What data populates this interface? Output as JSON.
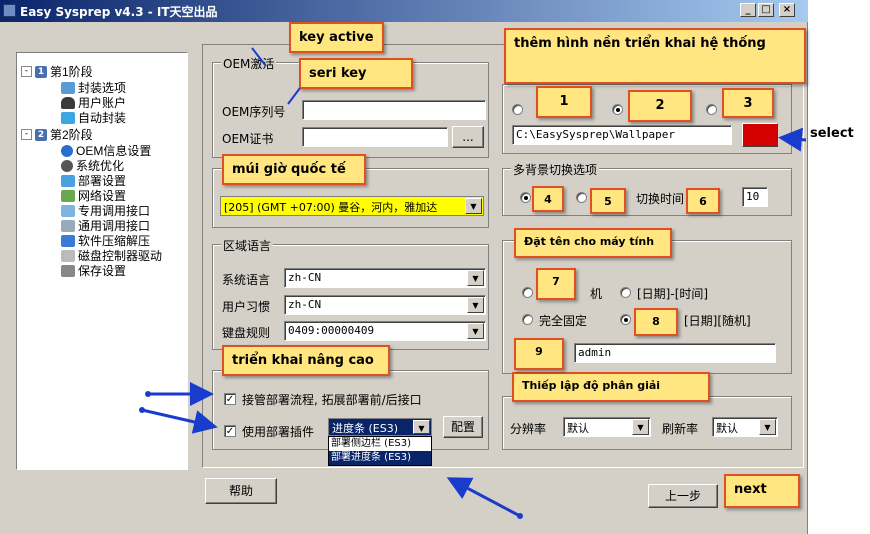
{
  "window": {
    "title": "Easy Sysprep v4.3 - IT天空出品",
    "min_label": "_",
    "max_label": "□",
    "close_label": "×"
  },
  "tree": {
    "stage1": {
      "num": "1",
      "label": "第1阶段"
    },
    "stage1_items": [
      "封装选项",
      "用户账户",
      "自动封装"
    ],
    "stage2": {
      "num": "2",
      "label": "第2阶段"
    },
    "stage2_items": [
      "OEM信息设置",
      "系统优化",
      "部署设置",
      "网络设置",
      "专用调用接口",
      "通用调用接口",
      "软件压缩解压",
      "磁盘控制器驱动",
      "保存设置"
    ]
  },
  "oem": {
    "group_label": "OEM激活",
    "serial_label": "OEM序列号",
    "serial_value": "",
    "cert_label": "OEM证书",
    "cert_value": "",
    "browse_label": "..."
  },
  "timezone": {
    "value": "[205] (GMT +07:00) 曼谷，河内，雅加达"
  },
  "locale": {
    "group_label": "区域语言",
    "system_language_label": "系统语言",
    "system_language_value": "zh-CN",
    "user_locale_label": "用户习惯",
    "user_locale_value": "zh-CN",
    "keyboard_label": "键盘规则",
    "keyboard_value": "0409:00000409"
  },
  "advanced": {
    "takeover_label": "接管部署流程, 拓展部署前/后接口",
    "plugin_label": "使用部署插件",
    "plugin_selected": "进度条 (ES3)",
    "plugin_options": [
      "部署侧边栏 (ES3)",
      "部署进度条 (ES3)"
    ],
    "config_label": "配置"
  },
  "wallpaper": {
    "path_value": "C:\\EasySysprep\\Wallpaper"
  },
  "multi_bg": {
    "group_label": "多背景切换选项",
    "interval_label": "切换时间",
    "interval_value": "10"
  },
  "computer_name": {
    "option_machine_suffix": "机",
    "option_date_time": "[日期]-[时间]",
    "option_fixed": "完全固定",
    "option_date_random_suffix": "[日期][随机]",
    "fixed_value": "admin"
  },
  "display": {
    "resolution_label": "分辨率",
    "resolution_value": "默认",
    "refresh_label": "刷新率",
    "refresh_value": "默认"
  },
  "footer": {
    "help_label": "帮助",
    "prev_label": "上一步"
  },
  "annotations": {
    "key_active": "key active",
    "seri_key": "seri key",
    "timezone": "múi giờ quốc tế",
    "wallpaper": "thêm hình nền triển khai hệ thống",
    "advanced": "triển khai nâng cao",
    "computer_name": "Đặt tên cho máy tính",
    "resolution": "Thiếp lập độ phân giải",
    "select": "select",
    "next": "next",
    "nums": [
      "1",
      "2",
      "3",
      "4",
      "5",
      "6",
      "7",
      "8",
      "9"
    ]
  },
  "colors": {
    "window_bg": "#d4d0c8",
    "titlebar": "#0a246a",
    "note_bg": "#ffe680",
    "note_border": "#e05020",
    "highlight_yellow": "#ffff00",
    "selection_blue": "#0a246a",
    "wallpaper_color": "#d40000",
    "arrow_blue": "#1a3ccc"
  }
}
